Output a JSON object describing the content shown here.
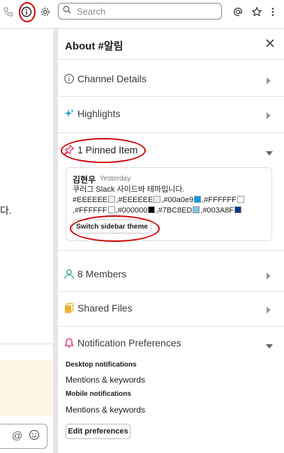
{
  "toolbar": {
    "search_placeholder": "Search",
    "icons": [
      "phone-icon",
      "info-icon",
      "gear-icon",
      "search-icon",
      "at-sign-icon",
      "star-icon",
      "more-vertical-icon"
    ]
  },
  "left_pane": {
    "stub_text": "다."
  },
  "panel": {
    "title": "About #알림",
    "sections": {
      "channel_details": "Channel Details",
      "highlights": "Highlights",
      "pinned": "1 Pinned Item",
      "members": "8 Members",
      "shared_files": "Shared Files",
      "notifications": "Notification Preferences"
    },
    "pinned_item": {
      "author": "김현우",
      "timestamp": "Yesterday",
      "line1": "쿠러그 Slack 사이드바 테마입니다.",
      "colors": [
        "#EEEEEE",
        "#EEEEEE",
        "#00a0e9",
        "#FFFFFF",
        "#FFFFFF",
        "#000000",
        "#7BC8ED",
        "#003A8F"
      ],
      "swatches": [
        "#EEEEEE",
        "#EEEEEE",
        "#00a0e9",
        "#FFFFFF",
        "#FFFFFF",
        "#000000",
        "#7BC8ED",
        "#003A8F"
      ],
      "button_label": "Switch sidebar theme"
    },
    "notifications": {
      "desktop_label": "Desktop notifications",
      "desktop_value": "Mentions & keywords",
      "mobile_label": "Mobile notifications",
      "mobile_value": "Mentions & keywords",
      "edit_button": "Edit preferences"
    }
  },
  "accent_colors": {
    "annotation_red": "#d00000",
    "highlights_blue": "#1d9bd1",
    "pinned_red": "#e01e5a",
    "members_green": "#2bac76",
    "files_orange": "#ecb22e"
  }
}
